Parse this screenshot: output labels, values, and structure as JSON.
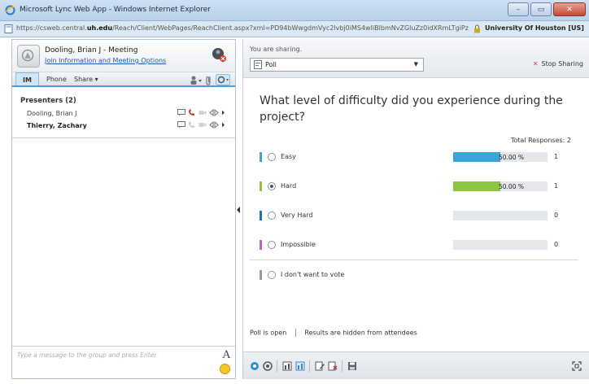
{
  "window": {
    "title": "Microsoft Lync Web App - Windows Internet Explorer",
    "buttons": [
      "–",
      "▭",
      "✕"
    ]
  },
  "address": {
    "url_prefix": "https://csweb.central.",
    "url_domain": "uh.edu",
    "url_rest": "/Reach/Client/WebPages/ReachClient.aspx?xml=PD94bWwgdmVyc2lvbj0iMS4wIiBlbmNvZGluZz0idXRmLTgiPz48Y29u",
    "org": "University Of Houston [US]"
  },
  "meeting": {
    "title": "Dooling, Brian J - Meeting",
    "info_link": "Join Information and Meeting Options"
  },
  "tabs": {
    "im": "IM",
    "phone": "Phone",
    "share": "Share ▾"
  },
  "presenters": {
    "header": "Presenters (2)",
    "people": [
      "Dooling, Brian J",
      "Thierry, Zachary"
    ]
  },
  "message_placeholder": "Type a message to the group and press Enter",
  "font_glyph": "A",
  "sharing": {
    "label": "You are sharing.",
    "selected": "Poll",
    "stop": "Stop Sharing"
  },
  "poll": {
    "question": "What level of difficulty did you experience during the project?",
    "total": "Total Responses: 2",
    "options": [
      {
        "label": "Easy",
        "pct_text": "50.00 %",
        "fraction": 0.5,
        "count": "1",
        "color": "#3aa6d8",
        "selected": false
      },
      {
        "label": "Hard",
        "pct_text": "50.00 %",
        "fraction": 0.5,
        "count": "1",
        "color": "#8cc63f",
        "selected": true
      },
      {
        "label": "Very Hard",
        "pct_text": "",
        "fraction": 0,
        "count": "0",
        "color": "#1e6fc4",
        "selected": false
      },
      {
        "label": "Impossible",
        "pct_text": "",
        "fraction": 0,
        "count": "0",
        "color": "#c65bc6",
        "selected": false
      }
    ],
    "no_vote": "I don't want to vote",
    "status_open": "Poll is open",
    "status_hidden": "Results are hidden from attendees"
  },
  "colors": {
    "accent": "#4aa0d8",
    "stop": "#d23a2a",
    "novote_mark": "#9a9a9a"
  }
}
